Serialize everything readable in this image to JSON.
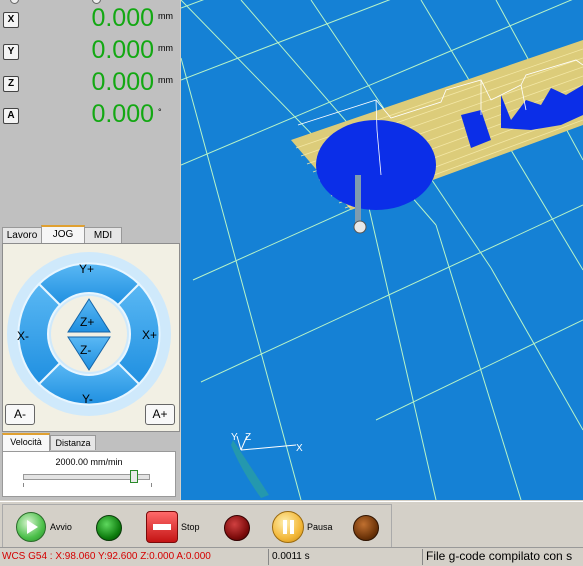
{
  "dro": {
    "axes": [
      {
        "label": "X",
        "value": "0.000",
        "unit": "mm"
      },
      {
        "label": "Y",
        "value": "0.000",
        "unit": "mm"
      },
      {
        "label": "Z",
        "value": "0.000",
        "unit": "mm"
      },
      {
        "label": "A",
        "value": "0.000",
        "unit": "°"
      }
    ]
  },
  "tabs": [
    {
      "label": "Lavoro"
    },
    {
      "label": "JOG"
    },
    {
      "label": "MDI"
    }
  ],
  "jog": {
    "y_plus": "Y+",
    "y_minus": "Y-",
    "x_plus": "X+",
    "x_minus": "X-",
    "z_plus": "Z+",
    "z_minus": "Z-",
    "a_minus": "A-",
    "a_plus": "A+"
  },
  "speed": {
    "tab_velocita": "Velocità",
    "tab_distanza": "Distanza",
    "value": "2000.00 mm/min",
    "slider_level": 0.88
  },
  "toolbar": {
    "start": "Avvio",
    "stop": "Stop",
    "pause": "Pausa"
  },
  "status": {
    "coords": "WCS G54 : X:98.060 Y:92.600 Z:0.000 A:0.000",
    "time": "0.0011 s",
    "message": "File g-code compilato con s"
  },
  "viewport": {
    "axis_labels": {
      "x": "X",
      "y": "Y",
      "z": "Z"
    }
  },
  "colors": {
    "viewport_bg": "#1581d5",
    "grid": "#b7f4c8",
    "dro_value": "#13a813",
    "jog_button": "#33a0ea",
    "status_coords": "#d40000"
  }
}
